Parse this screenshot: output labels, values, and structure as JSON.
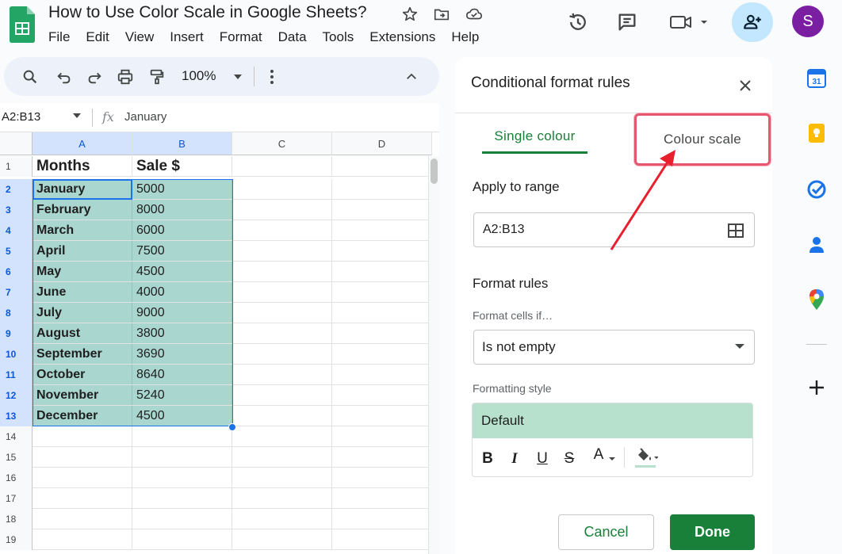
{
  "app": {
    "doc_title": "How to Use Color Scale in Google Sheets?",
    "menu": [
      "File",
      "Edit",
      "View",
      "Insert",
      "Format",
      "Data",
      "Tools",
      "Extensions",
      "Help"
    ],
    "avatar_initial": "S",
    "icons": {
      "logo": "sheets-logo-icon",
      "star": "star-icon",
      "move": "move-to-folder-icon",
      "cloud": "cloud-status-icon",
      "history": "version-history-icon",
      "comments": "comments-icon",
      "meet": "video-call-icon",
      "share": "add-person-icon"
    },
    "colors": {
      "accent_green": "#188038",
      "selection_blue": "#1a73e8",
      "scale_fill": "#a9d6cf",
      "highlight_box": "#e8566f",
      "annotation_arrow": "#e8202e"
    }
  },
  "toolbar": {
    "zoom": "100%",
    "icons": [
      "search-icon",
      "undo-icon",
      "redo-icon",
      "print-icon",
      "paint-format-icon",
      "more-icon",
      "collapse-icon"
    ]
  },
  "formula_bar": {
    "name_box": "A2:B13",
    "fx": "fx",
    "value": "January"
  },
  "sheet": {
    "columns": [
      "A",
      "B",
      "C",
      "D"
    ],
    "header_row": {
      "row": "1",
      "a": "Months",
      "b": "Sale $"
    },
    "rows": [
      {
        "row": "2",
        "a": "January",
        "b": "5000"
      },
      {
        "row": "3",
        "a": "February",
        "b": "8000"
      },
      {
        "row": "4",
        "a": "March",
        "b": "6000"
      },
      {
        "row": "5",
        "a": "April",
        "b": "7500"
      },
      {
        "row": "6",
        "a": "May",
        "b": "4500"
      },
      {
        "row": "7",
        "a": "June",
        "b": "4000"
      },
      {
        "row": "8",
        "a": "July",
        "b": "9000"
      },
      {
        "row": "9",
        "a": "August",
        "b": "3800"
      },
      {
        "row": "10",
        "a": "September",
        "b": "3690"
      },
      {
        "row": "11",
        "a": "October",
        "b": "8640"
      },
      {
        "row": "12",
        "a": "November",
        "b": "5240"
      },
      {
        "row": "13",
        "a": "December",
        "b": "4500"
      }
    ],
    "empty_rows": [
      "14",
      "15",
      "16",
      "17",
      "18",
      "19"
    ]
  },
  "panel": {
    "title": "Conditional format rules",
    "tab_single": "Single colour",
    "tab_scale": "Colour scale",
    "apply_label": "Apply to range",
    "range_value": "A2:B13",
    "format_rules_label": "Format rules",
    "format_cells_if_label": "Format cells if…",
    "condition_value": "Is not empty",
    "formatting_style_label": "Formatting style",
    "style_preview": "Default",
    "style_tools": {
      "bold": "B",
      "italic": "I",
      "underline": "U",
      "strike": "S",
      "text_color": "A"
    },
    "cancel": "Cancel",
    "done": "Done"
  },
  "side_rail": [
    "calendar-icon",
    "keep-icon",
    "tasks-icon",
    "contacts-icon",
    "maps-icon",
    "add-icon"
  ]
}
